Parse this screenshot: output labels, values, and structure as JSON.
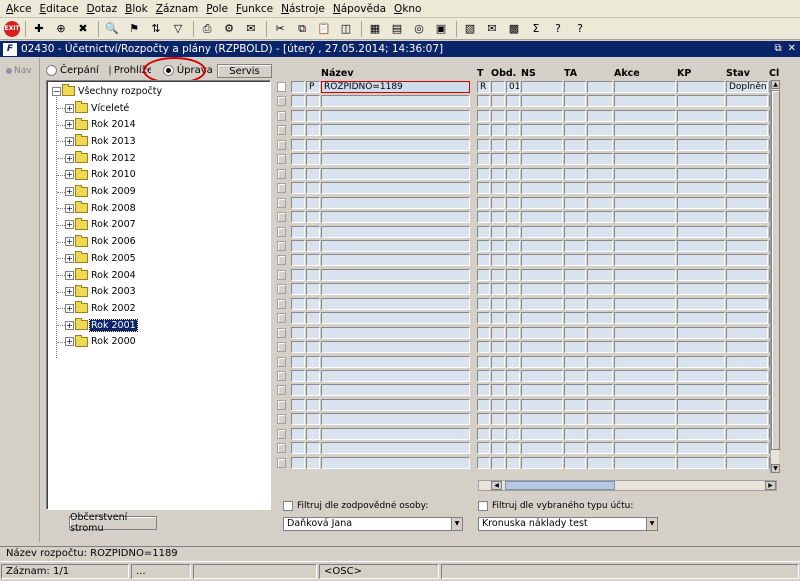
{
  "menu": [
    "Akce",
    "Editace",
    "Dotaz",
    "Blok",
    "Záznam",
    "Pole",
    "Funkce",
    "Nástroje",
    "Nápověda",
    "Okno"
  ],
  "toolbar": {
    "exit_label": "EXIT",
    "icons": [
      "new-record-icon",
      "insert-icon",
      "delete-icon",
      "query-icon",
      "execute-query-icon",
      "sort-icon",
      "filter-icon",
      "print-icon",
      "print-setup-icon",
      "mail-icon",
      "cut-icon",
      "copy-icon",
      "paste-icon",
      "clear-icon",
      "calculator-icon",
      "document-icon",
      "globe-icon",
      "save-icon",
      "report-icon",
      "email-icon",
      "excel-icon",
      "sum-icon",
      "help-icon",
      "context-help-icon"
    ]
  },
  "window": {
    "logo": "F",
    "title": "02430 - Účetnictví/Rozpočty a plány (RZPBOLD) - [úterý  , 27.05.2014; 14:36:07]",
    "controls": [
      "⧉",
      "✕"
    ]
  },
  "nav": {
    "label": "Nav"
  },
  "modes": [
    {
      "label": "Čerpání",
      "selected": false
    },
    {
      "label": "Prohlížení",
      "selected": false
    },
    {
      "label": "Úprava",
      "selected": true
    }
  ],
  "servis_label": "Servis",
  "tree": {
    "root": "Všechny rozpočty",
    "items": [
      {
        "label": "Víceleté",
        "selected": false
      },
      {
        "label": "Rok 2014",
        "selected": false
      },
      {
        "label": "Rok 2013",
        "selected": false
      },
      {
        "label": "Rok 2012",
        "selected": false
      },
      {
        "label": "Rok 2010",
        "selected": false
      },
      {
        "label": "Rok 2009",
        "selected": false
      },
      {
        "label": "Rok 2008",
        "selected": false
      },
      {
        "label": "Rok 2007",
        "selected": false
      },
      {
        "label": "Rok 2006",
        "selected": false
      },
      {
        "label": "Rok 2005",
        "selected": false
      },
      {
        "label": "Rok 2004",
        "selected": false
      },
      {
        "label": "Rok 2003",
        "selected": false
      },
      {
        "label": "Rok 2002",
        "selected": false
      },
      {
        "label": "Rok 2001",
        "selected": true
      },
      {
        "label": "Rok 2000",
        "selected": false
      }
    ]
  },
  "refresh_label": "Občerstvení stromu",
  "grid": {
    "columns": [
      "Název",
      "T",
      "Obd.",
      "NS",
      "TA",
      "Akce",
      "KP",
      "Stav",
      "Cl"
    ],
    "first_row": {
      "flag": "P",
      "nazev": "ROZPIDNO=1189",
      "t": "R",
      "obd": "01",
      "stav": "Doplněn"
    },
    "row_count": 27
  },
  "filters": {
    "person_label": "Filtruj dle zodpovědné osoby:",
    "person_value": "Daňková Jana",
    "account_label": "Filtruj dle vybraného typu účtu:",
    "account_value": "Kronuska náklady test"
  },
  "status": {
    "line": "Název rozpočtu: ROZPIDNO=1189",
    "record": "Záznam: 1/1",
    "seg2": "...",
    "seg3": "",
    "osc": "<OSC>"
  }
}
